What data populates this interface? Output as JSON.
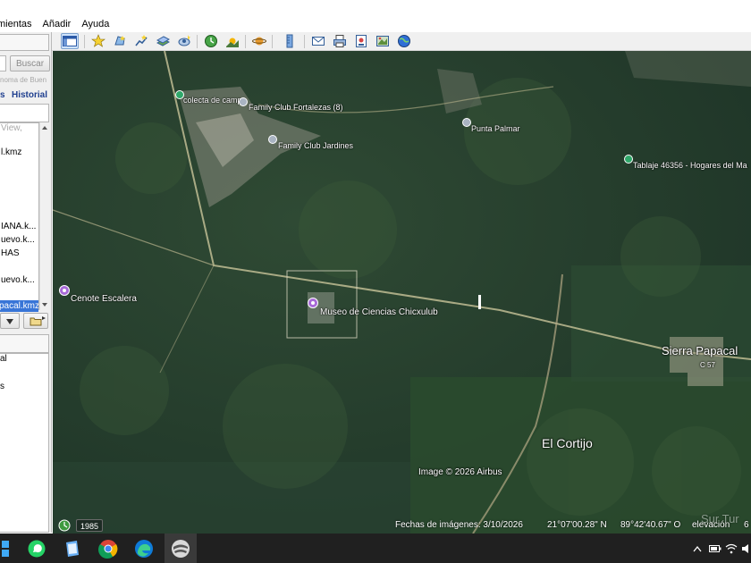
{
  "menu": {
    "items": [
      "mientas",
      "Añadir",
      "Ayuda"
    ]
  },
  "toolbar": {
    "buttons": [
      "sidebar-toggle-icon",
      "placemark-icon",
      "polygon-icon",
      "path-icon",
      "overlay-icon",
      "tour-icon",
      "historical-imagery-icon",
      "sunlight-icon",
      "planet-icon",
      "ruler-icon",
      "email-icon",
      "print-icon",
      "save-image-icon",
      "map-view-icon",
      "web-icon"
    ]
  },
  "left_panel": {
    "search_button": "Buscar",
    "search_hint": "noma de Buen",
    "tab_places_partial": "s",
    "tab_history": "Historial",
    "list_items": [
      "View,",
      "l.kmz",
      "IANA.k...",
      "uevo.k...",
      "HAS",
      "uevo.k...",
      "pacal.kmz"
    ],
    "layers_items": [
      "al",
      "s"
    ]
  },
  "map": {
    "pins": [
      {
        "label": "colecta de campo",
        "type": "green"
      },
      {
        "label": "Family Club Fortalezas (8)",
        "type": "grey"
      },
      {
        "label": "Family Club Jardines",
        "type": "grey"
      },
      {
        "label": "Punta Palmar",
        "type": "grey"
      },
      {
        "label": "Tablaje 46356 -  Hogares del Ma",
        "type": "green"
      },
      {
        "label": "Cenote Escalera",
        "type": "purple"
      },
      {
        "label": "Museo de Ciencias Chicxulub",
        "type": "purple"
      }
    ],
    "places": {
      "sierra": "Sierra Papacal",
      "cortijo": "El Cortijo",
      "sierra_sub": "C 57"
    },
    "copyright": "Image © 2026 Airbus"
  },
  "status": {
    "year": "1985",
    "imagery_date": "Fechas de imágenes: 3/10/2026",
    "lat": "21°07'00.28\" N",
    "lon": "89°42'40.67\" O",
    "elevation": "elevación",
    "elevation_partial": "6",
    "watermark": "Sur Tur"
  },
  "taskbar": {
    "apps": [
      "start-icon",
      "whatsapp-icon",
      "notes-icon",
      "chrome-icon",
      "edge-icon",
      "google-earth-icon"
    ],
    "tray": [
      "show-hidden-icon",
      "battery-icon",
      "wifi-icon",
      "volume-icon"
    ]
  }
}
